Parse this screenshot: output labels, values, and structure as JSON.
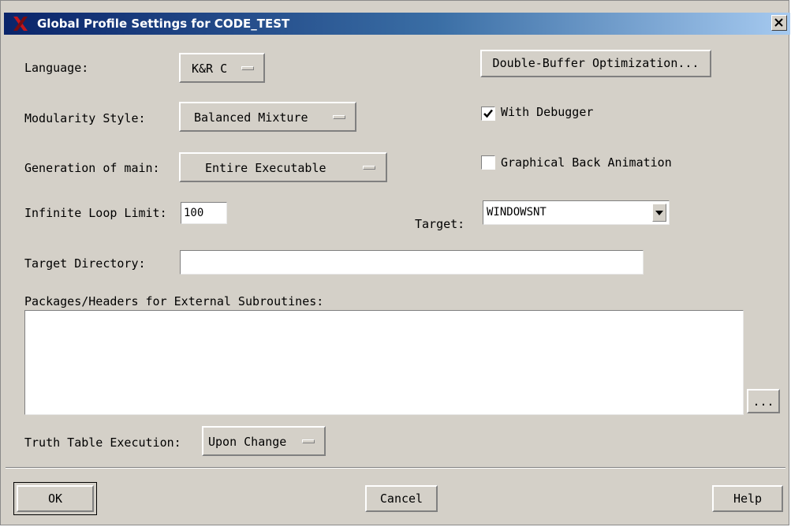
{
  "window": {
    "title": "Global Profile Settings for CODE_TEST",
    "close_label": "x"
  },
  "language": {
    "label": "Language:",
    "value": "K&R C"
  },
  "modularity": {
    "label": "Modularity Style:",
    "value": "Balanced Mixture"
  },
  "generation": {
    "label": "Generation of main:",
    "value": "Entire Executable"
  },
  "loop_limit": {
    "label": "Infinite Loop Limit:",
    "value": "100"
  },
  "target": {
    "label": "Target:",
    "value": "WINDOWSNT"
  },
  "target_directory": {
    "label": "Target Directory:",
    "value": ""
  },
  "packages": {
    "label": "Packages/Headers for External Subroutines:",
    "value": "",
    "browse_label": "..."
  },
  "truth_table": {
    "label": "Truth Table Execution:",
    "value": "Upon Change"
  },
  "double_buffer_label": "Double-Buffer Optimization...",
  "with_debugger": {
    "label": "With Debugger",
    "checked": true
  },
  "graphical_back_animation": {
    "label": "Graphical Back Animation",
    "checked": false
  },
  "buttons": {
    "ok": "OK",
    "cancel": "Cancel",
    "help": "Help"
  },
  "colors": {
    "titlebar_start": "#0a246a",
    "titlebar_end": "#a6caf0",
    "dialog_bg": "#d4d0c8",
    "app_icon": "#c4161c"
  },
  "icons": {
    "app": "x-logo-icon",
    "close": "close-icon",
    "dropdown": "dropdown-arrow-icon",
    "check": "checkmark-icon"
  }
}
